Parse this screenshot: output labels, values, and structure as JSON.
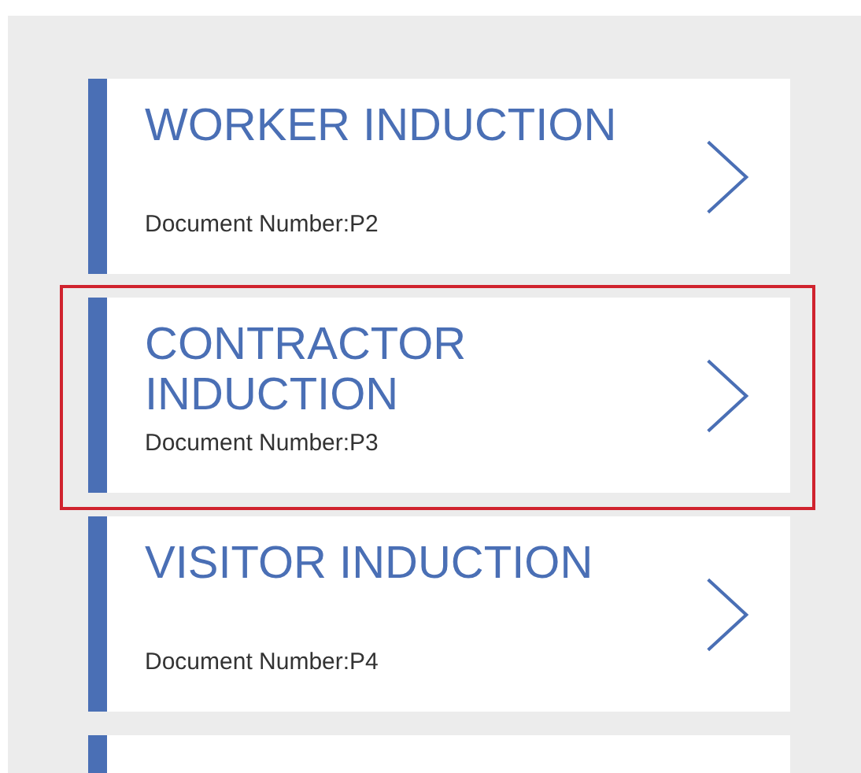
{
  "inductions": [
    {
      "title": "WORKER INDUCTION",
      "document_number": "Document Number:P2",
      "selected": false
    },
    {
      "title": "CONTRACTOR INDUCTION",
      "document_number": "Document Number:P3",
      "selected": true
    },
    {
      "title": "VISITOR INDUCTION",
      "document_number": "Document Number:P4",
      "selected": false
    },
    {
      "selected": false
    }
  ]
}
